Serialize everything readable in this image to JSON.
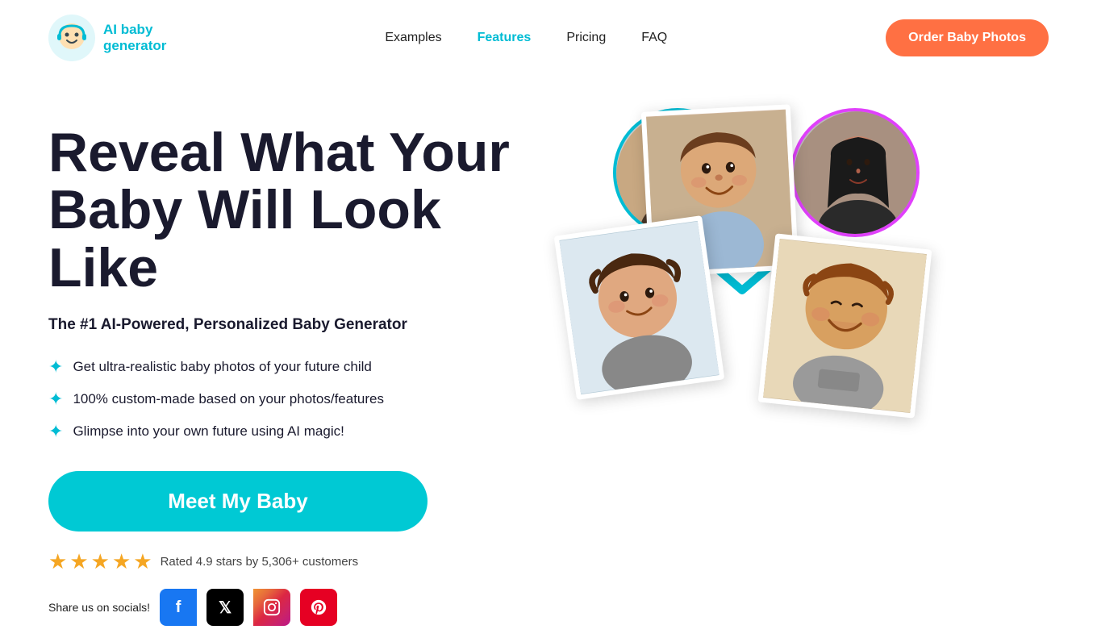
{
  "logo": {
    "line1": "AI baby",
    "line2": "generator"
  },
  "nav": {
    "links": [
      {
        "label": "Examples",
        "active": false
      },
      {
        "label": "Features",
        "active": true
      },
      {
        "label": "Pricing",
        "active": false
      },
      {
        "label": "FAQ",
        "active": false
      }
    ],
    "cta_label": "Order Baby Photos"
  },
  "hero": {
    "title_line1": "Reveal What Your",
    "title_line2": "Baby Will Look Like",
    "subtitle": "The #1 AI-Powered, Personalized Baby Generator",
    "features": [
      "Get ultra-realistic baby photos of your future child",
      "100% custom-made based on your photos/features",
      "Glimpse into your own future using AI magic!"
    ],
    "cta_label": "Meet My Baby",
    "rating_text": "Rated 4.9 stars by 5,306+ customers",
    "share_label": "Share us on socials!",
    "stars": [
      "★",
      "★",
      "★",
      "★",
      "★"
    ]
  },
  "social": {
    "facebook_label": "f",
    "twitter_label": "𝕏",
    "instagram_label": "📷",
    "pinterest_label": "𝗣"
  },
  "colors": {
    "accent_cyan": "#00c9d4",
    "accent_orange": "#ff7043",
    "accent_pink": "#e040fb",
    "accent_green": "#4caf50",
    "star_gold": "#f5a623"
  }
}
